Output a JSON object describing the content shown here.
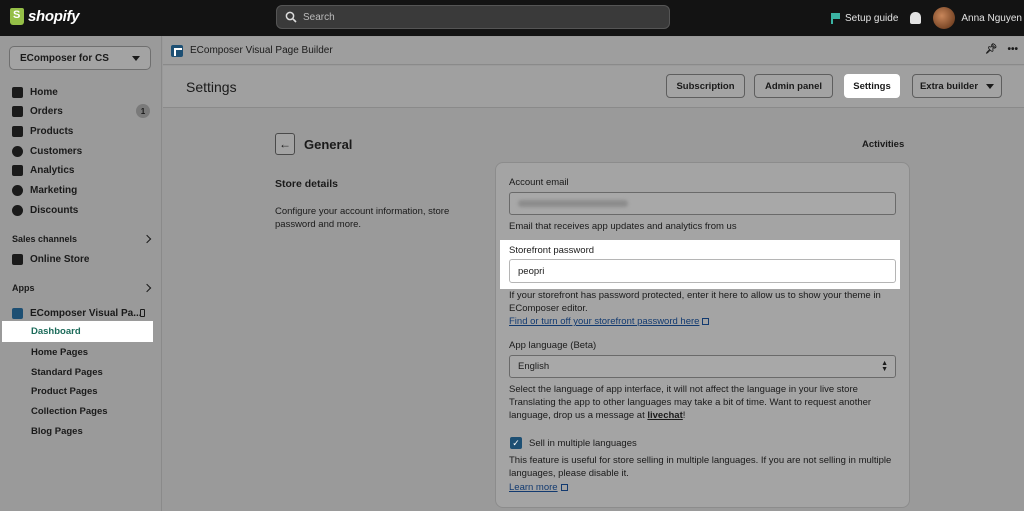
{
  "topbar": {
    "brand": "shopify",
    "search_placeholder": "Search",
    "setup_guide": "Setup guide",
    "user_name": "Anna Nguyen"
  },
  "sidebar": {
    "store_name": "EComposer for CS",
    "items": [
      {
        "label": "Home",
        "icon": "home-icon"
      },
      {
        "label": "Orders",
        "icon": "orders-icon",
        "badge": "1"
      },
      {
        "label": "Products",
        "icon": "tag-icon"
      },
      {
        "label": "Customers",
        "icon": "person-icon"
      },
      {
        "label": "Analytics",
        "icon": "analytics-icon"
      },
      {
        "label": "Marketing",
        "icon": "marketing-icon"
      },
      {
        "label": "Discounts",
        "icon": "discount-icon"
      }
    ],
    "sales_channels": "Sales channels",
    "online_store": "Online Store",
    "apps": "Apps",
    "app_name": "EComposer Visual Pa...",
    "app_pages": [
      "Dashboard",
      "Home Pages",
      "Standard Pages",
      "Product Pages",
      "Collection Pages",
      "Blog Pages"
    ]
  },
  "appbar": {
    "title": "EComposer Visual Page Builder"
  },
  "page": {
    "title": "Settings",
    "buttons": {
      "subscription": "Subscription",
      "admin_panel": "Admin panel",
      "settings": "Settings",
      "extra_builder": "Extra builder"
    },
    "section_title": "General",
    "activities": "Activities",
    "store_details_title": "Store details",
    "store_details_desc": "Configure your account information, store password and more."
  },
  "form": {
    "account_email_label": "Account email",
    "account_email_help": "Email that receives app updates and analytics from us",
    "storefront_password_label": "Storefront password",
    "storefront_password_value": "peopri",
    "storefront_help_1": "If your storefront has password protected, enter it here to allow us to show your theme in",
    "storefront_help_2": "EComposer editor.",
    "storefront_link": "Find or turn off your storefront password here",
    "language_label": "App language (Beta)",
    "language_value": "English",
    "language_help_1": "Select the language of app interface, it will not affect the language in your live store",
    "language_help_2": "Translating the app to other languages may take a bit of time. Want to request another",
    "language_help_3": "language, drop us a message at",
    "livechat": "livechat",
    "livechat_suffix": "!",
    "multi_lang_label": "Sell in multiple languages",
    "multi_lang_checked": true,
    "multi_lang_help_1": "This feature is useful for store selling in multiple languages. If you are not selling in multiple",
    "multi_lang_help_2": "languages, please disable it.",
    "learn_more": "Learn more"
  }
}
